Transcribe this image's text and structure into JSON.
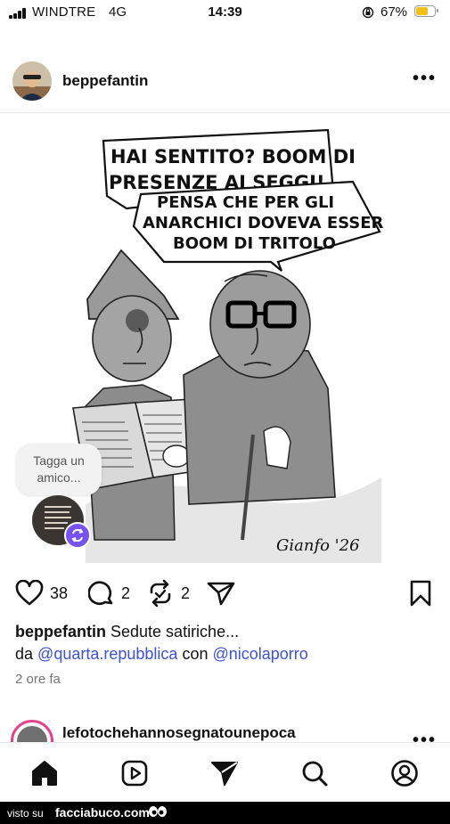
{
  "status_bar": {
    "carrier": "WINDTRE",
    "network": "4G",
    "time": "14:39",
    "battery": "67%",
    "battery_level": 0.67
  },
  "post": {
    "username": "beppefantin",
    "more_label": "•••",
    "cartoon": {
      "speech1": [
        "HAI SENTITO? BOOM DI",
        "PRESENZE AI SEGGI!"
      ],
      "speech2": [
        "PENSA CHE PER GLI",
        "ANARCHICI DOVEVA ESSERE",
        "BOOM DI TRITOLO"
      ],
      "signature": "Gianfo '26"
    },
    "tag_prompt": "Tagga un amico...",
    "likes": "38",
    "comments": "2",
    "reposts": "2",
    "caption_text": " Sedute satiriche...",
    "caption_prefix": "da",
    "mention1": "@quarta.repubblica",
    "caption_conj": "con",
    "mention2": "@nicolaporro",
    "time_ago": "2 ore fa"
  },
  "next_post": {
    "username": "lefotochehannosegnatounepoca"
  },
  "watermark": {
    "prefix": "visto su",
    "site": "facciabuco.com"
  },
  "colors": {
    "mention": "#3b52d9",
    "repost_badge": "#7652f2",
    "battery_fill": "#f2c21a",
    "story_ring": "#e2448c"
  }
}
